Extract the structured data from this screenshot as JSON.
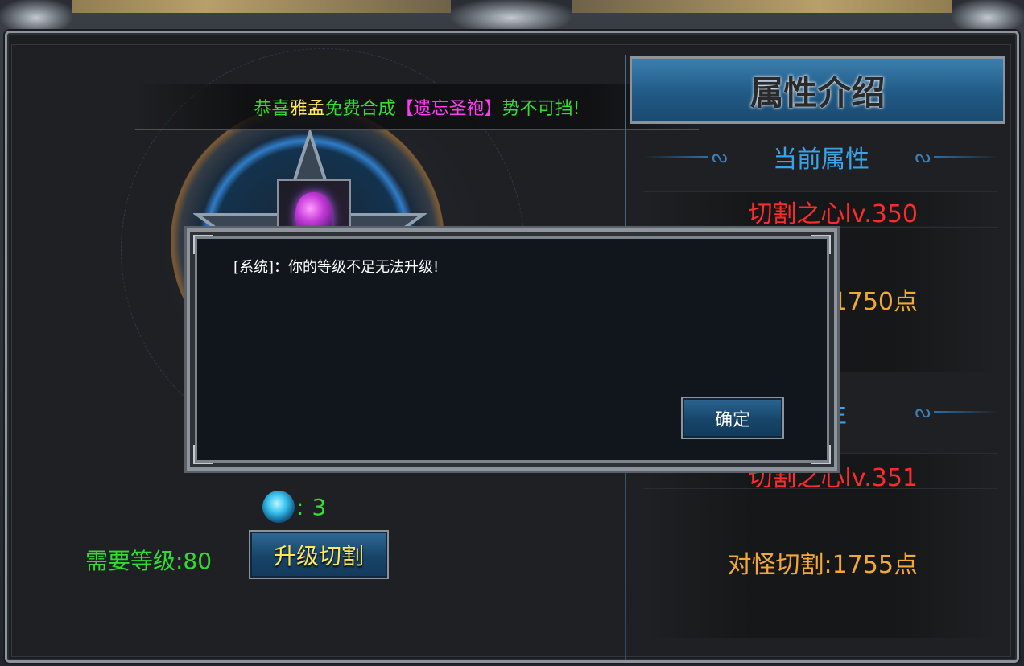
{
  "announcement": {
    "prefix": "恭喜",
    "player": "雅孟",
    "middle": "免费合成",
    "item": "【遗忘圣袍】",
    "suffix": "势不可挡!"
  },
  "left": {
    "stone_separator": ":",
    "stone_count": "3",
    "required_level": "需要等级:80",
    "upgrade_button": "升级切割",
    "item_icon": "purple-gem-icon",
    "stone_icon": "blue-crystal-icon"
  },
  "right": {
    "title": "属性介绍",
    "current_header": "当前属性",
    "current_name": "切割之心lv.350",
    "current_value": "1750点",
    "next_header_partial": "性",
    "next_name": "切割之心lv.351",
    "next_value": "对怪切割:1755点"
  },
  "dialog": {
    "message": "[系统]：你的等级不足无法升级!",
    "ok_button": "确定"
  },
  "colors": {
    "announce_green": "#32e032",
    "player_yellow": "#ffe85a",
    "item_magenta": "#ff3cf0",
    "attr_red": "#ff2a2a",
    "attr_orange": "#f2a834",
    "header_blue": "#3aa2e6"
  }
}
